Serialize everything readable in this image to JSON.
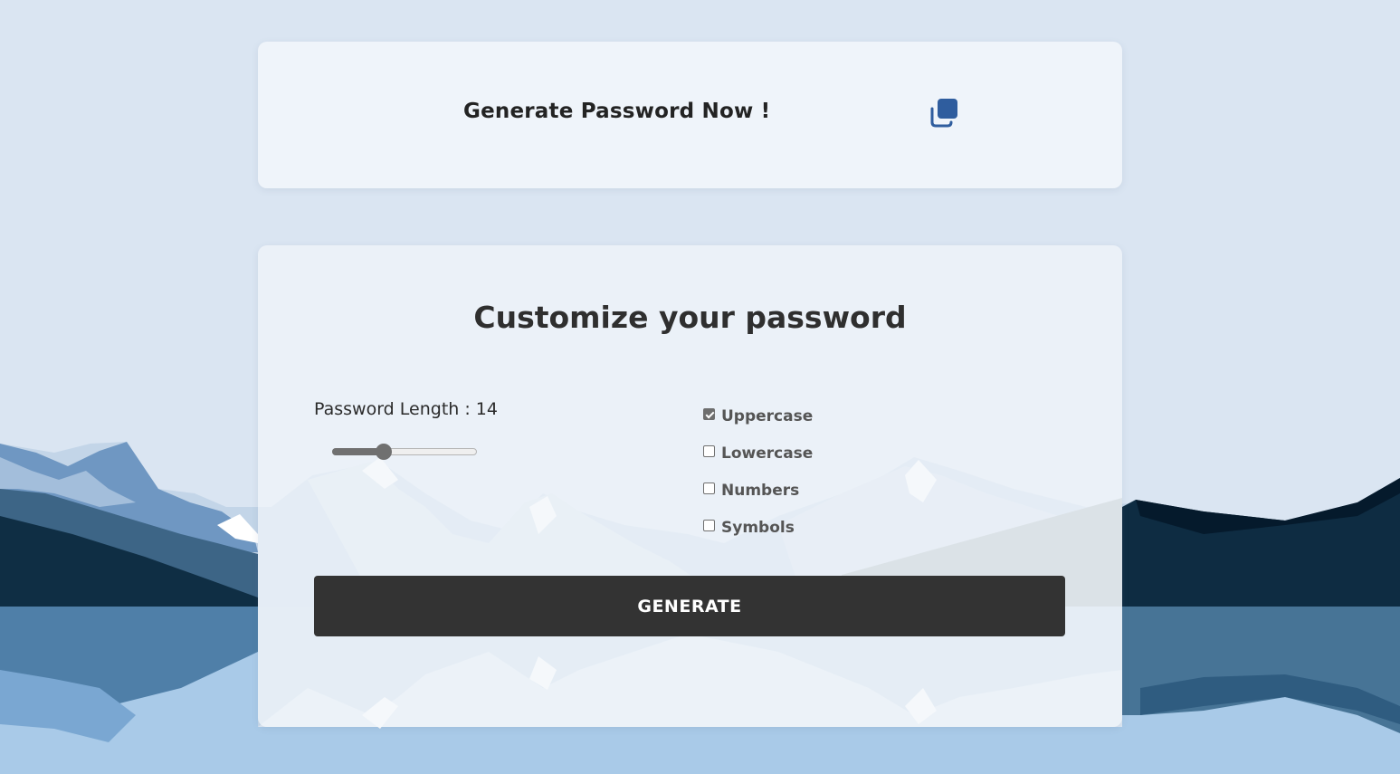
{
  "display": {
    "password_text": "Generate Password Now !",
    "copy_icon": "copy-icon"
  },
  "settings": {
    "title": "Customize your password",
    "length_label": "Password Length : 14",
    "length_value": 14,
    "length_min": 4,
    "length_max": 32,
    "options": [
      {
        "label": "Uppercase",
        "checked": true
      },
      {
        "label": "Lowercase",
        "checked": false
      },
      {
        "label": "Numbers",
        "checked": false
      },
      {
        "label": "Symbols",
        "checked": false
      }
    ],
    "generate_label": "GENERATE"
  },
  "colors": {
    "accent": "#2f5d9e",
    "button": "#333333",
    "background": "#dae5f2"
  }
}
